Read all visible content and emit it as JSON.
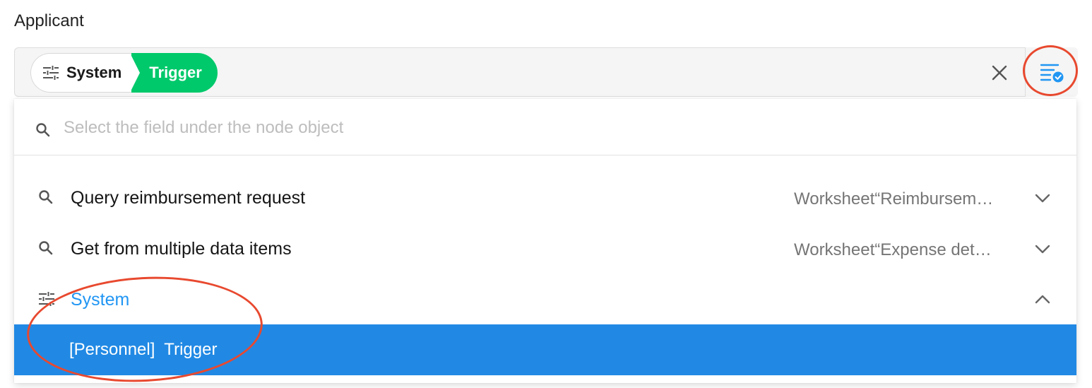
{
  "field": {
    "label": "Applicant"
  },
  "selected_tag": {
    "node": "System",
    "field": "Trigger",
    "node_icon": "sliders-icon"
  },
  "toolbar": {
    "clear_icon": "close-icon",
    "picker_icon": "field-list-check-icon"
  },
  "search": {
    "placeholder": "Select the field under the node object",
    "value": "",
    "icon": "search-icon"
  },
  "groups": [
    {
      "name": "Query reimbursement request",
      "source": "Worksheet“Reimbursement request”",
      "icon": "search-icon",
      "expanded": false
    },
    {
      "name": "Get from multiple data items",
      "source": "Worksheet“Expense details”",
      "icon": "search-icon",
      "expanded": false
    },
    {
      "name": "System",
      "source": "",
      "icon": "sliders-icon",
      "expanded": true
    }
  ],
  "options": [
    {
      "label": "[Personnel]  Trigger",
      "selected": true
    }
  ],
  "colors": {
    "accent": "#2196f3",
    "selected_row": "#2189e4",
    "tag_green": "#00c96b",
    "annotation": "#e8492f"
  }
}
